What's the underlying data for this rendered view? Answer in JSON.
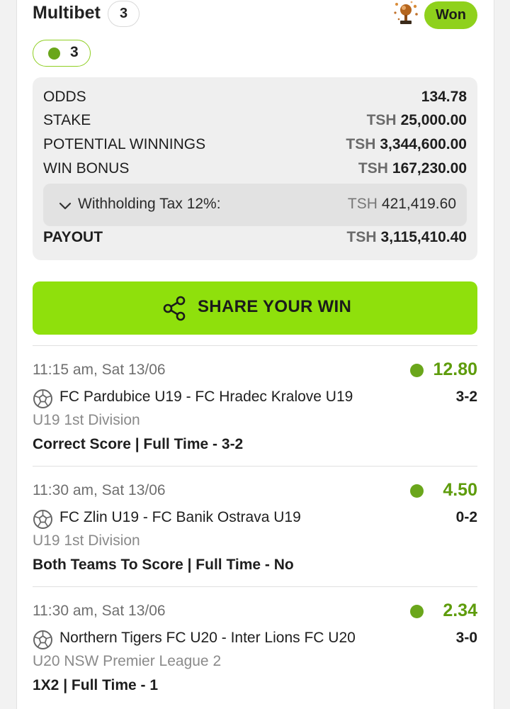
{
  "header": {
    "title": "Multibet",
    "selections_count": "3",
    "status": "Won",
    "trophy_icon": "trophy-icon"
  },
  "won_pill": {
    "count": "3"
  },
  "summary": {
    "odds_label": "ODDS",
    "odds_value": "134.78",
    "stake_label": "STAKE",
    "stake_currency": "TSH",
    "stake_value": "25,000.00",
    "potential_label": "POTENTIAL WINNINGS",
    "potential_currency": "TSH",
    "potential_value": "3,344,600.00",
    "bonus_label": "WIN BONUS",
    "bonus_currency": "TSH",
    "bonus_value": "167,230.00",
    "tax_label": "Withholding Tax 12%:",
    "tax_currency": "TSH",
    "tax_value": "421,419.60",
    "payout_label": "PAYOUT",
    "payout_currency": "TSH",
    "payout_value": "3,115,410.40"
  },
  "share": {
    "label": "SHARE YOUR WIN",
    "icon": "share-icon"
  },
  "selections": [
    {
      "time": "11:15 am, Sat 13/06",
      "odds": "12.80",
      "match": "FC Pardubice U19 - FC Hradec Kralove U19",
      "score": "3-2",
      "league": "U19 1st Division",
      "market": "Correct Score | Full Time - 3-2"
    },
    {
      "time": "11:30 am, Sat 13/06",
      "odds": "4.50",
      "match": "FC Zlin U19 - FC Banik Ostrava U19",
      "score": "0-2",
      "league": "U19 1st Division",
      "market": "Both Teams To Score | Full Time - No"
    },
    {
      "time": "11:30 am, Sat 13/06",
      "odds": "2.34",
      "match": "Northern Tigers FC U20 - Inter Lions FC U20",
      "score": "3-0",
      "league": "U20 NSW Premier League 2",
      "market": "1X2 | Full Time - 1"
    }
  ],
  "colors": {
    "accent": "#8fe00c",
    "won_dot": "#6aa61b",
    "odds_green": "#5e9c0c"
  }
}
